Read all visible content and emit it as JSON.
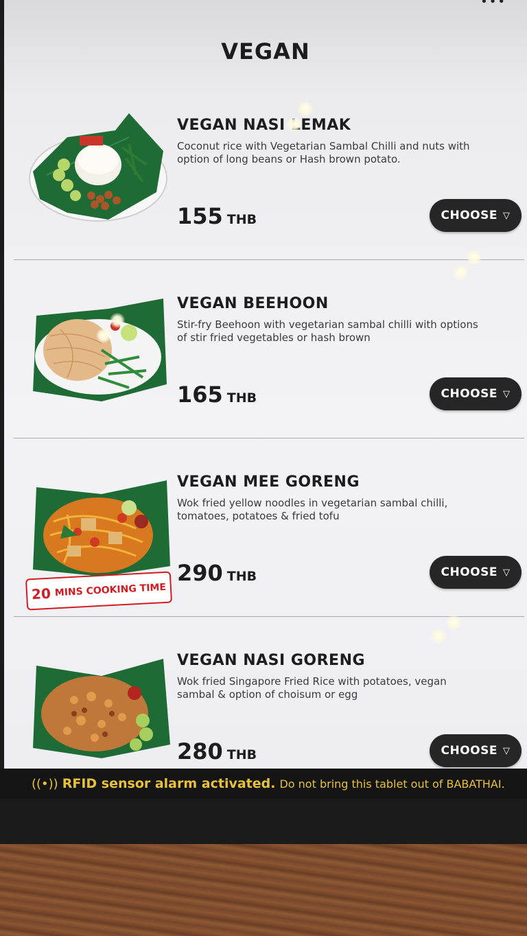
{
  "page": {
    "title": "VEGAN"
  },
  "dishes": [
    {
      "name": "VEGAN NASI LEMAK",
      "description": "Coconut rice with Vegetarian Sambal Chilli and nuts with option of long beans or Hash brown potato.",
      "price": "155",
      "currency": "THB",
      "button_label": "CHOOSE",
      "button_icon": "▽"
    },
    {
      "name": "VEGAN BEEHOON",
      "description": "Stir-fry Beehoon with vegetarian sambal chilli with options of stir fried vegetables or hash brown",
      "price": "165",
      "currency": "THB",
      "button_label": "CHOOSE",
      "button_icon": "▽"
    },
    {
      "name": "VEGAN MEE GORENG",
      "description": "Wok fried yellow noodles in vegetarian sambal chilli, tomatoes, potatoes & fried tofu",
      "price": "290",
      "currency": "THB",
      "button_label": "CHOOSE",
      "button_icon": "▽",
      "badge_number": "20",
      "badge_text": "MINS COOKING TIME"
    },
    {
      "name": "VEGAN NASI GORENG",
      "description": "Wok fried Singapore Fried Rice with potatoes, vegan sambal & option of choisum or egg",
      "price": "280",
      "currency": "THB",
      "button_label": "CHOOSE",
      "button_icon": "▽"
    }
  ],
  "footer": {
    "icon": "((•))",
    "emphasis": "RFID sensor alarm activated.",
    "message": "Do not bring this tablet out of BABATHAI."
  },
  "colors": {
    "button_bg": "#262626",
    "badge_red": "#d11d22",
    "footer_text": "#e7c13a",
    "banana_leaf": "#1f6b35"
  }
}
